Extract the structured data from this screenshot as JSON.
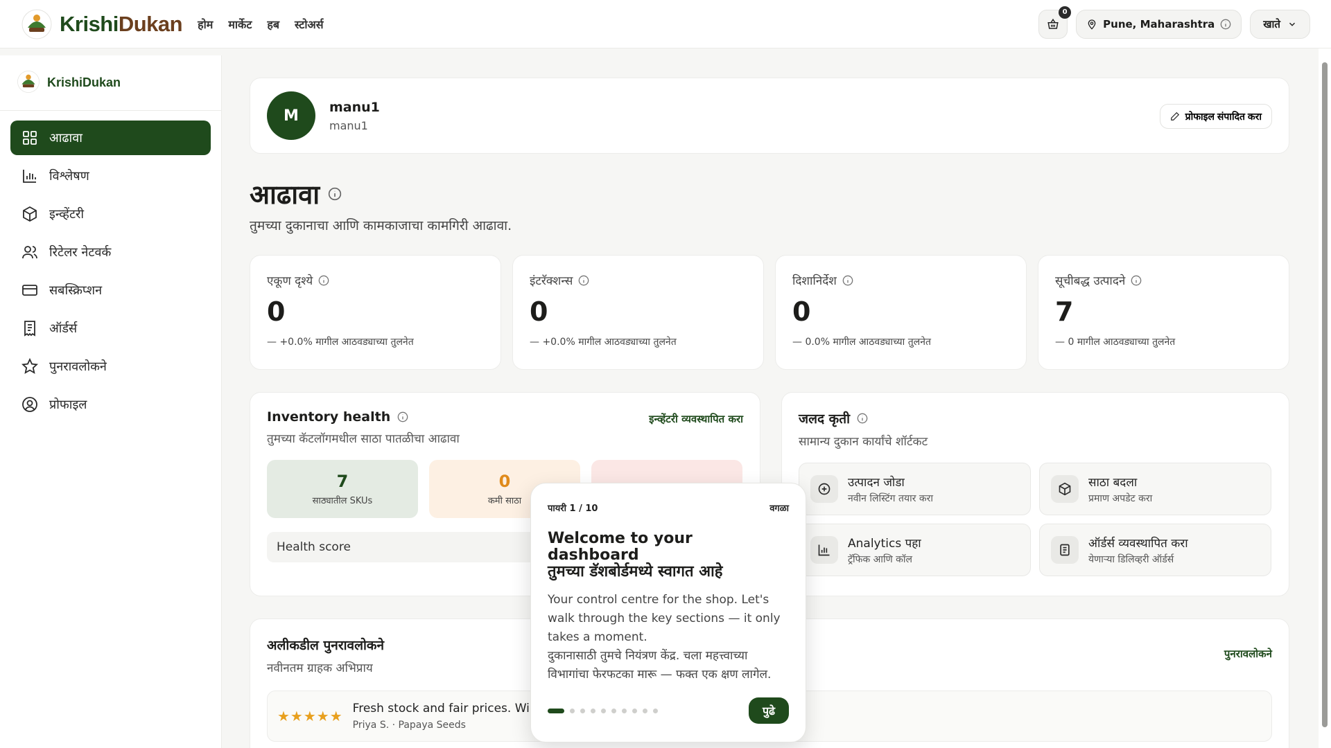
{
  "topbar": {
    "brand_k": "Krishi",
    "brand_d": "Dukan",
    "nav": [
      "होम",
      "मार्केट",
      "हब",
      "स्टोअर्स"
    ],
    "cart_count": "0",
    "location": "Pune, Maharashtra",
    "account": "खाते"
  },
  "sidebar": {
    "brand": "KrishiDukan",
    "items": [
      {
        "label": "आढावा",
        "icon": "grid-icon"
      },
      {
        "label": "विश्लेषण",
        "icon": "bar-chart-icon"
      },
      {
        "label": "इन्व्हेंटरी",
        "icon": "box-icon"
      },
      {
        "label": "रिटेलर नेटवर्क",
        "icon": "users-icon"
      },
      {
        "label": "सबस्क्रिप्शन",
        "icon": "card-icon"
      },
      {
        "label": "ऑर्डर्स",
        "icon": "receipt-icon"
      },
      {
        "label": "पुनरावलोकने",
        "icon": "star-icon"
      },
      {
        "label": "प्रोफाइल",
        "icon": "user-circle-icon"
      }
    ]
  },
  "profile": {
    "initial": "M",
    "name": "manu1",
    "username": "manu1",
    "edit_label": "प्रोफाइल संपादित करा"
  },
  "page": {
    "title": "आढावा",
    "subtitle": "तुमच्या दुकानाचा आणि कामकाजाचा कामगिरी आढावा."
  },
  "stats": [
    {
      "label": "एकूण दृश्ये",
      "value": "0",
      "change": "— +0.0%",
      "suffix": "मागील आठवड्याच्या तुलनेत"
    },
    {
      "label": "इंटरॅक्शन्स",
      "value": "0",
      "change": "— +0.0%",
      "suffix": "मागील आठवड्याच्या तुलनेत"
    },
    {
      "label": "दिशानिर्देश",
      "value": "0",
      "change": "— 0.0%",
      "suffix": "मागील आठवड्याच्या तुलनेत"
    },
    {
      "label": "सूचीबद्ध उत्पादने",
      "value": "7",
      "change": "— 0",
      "suffix": "मागील आठवड्याच्या तुलनेत"
    }
  ],
  "inventory": {
    "title": "Inventory health",
    "subtitle": "तुमच्या कॅटलॉगमधील साठा पातळीचा आढावा",
    "manage_link": "इन्व्हेंटरी व्यवस्थापित करा",
    "tiles": [
      {
        "value": "7",
        "label": "साठ्यातील SKUs",
        "bg": "#e4ebe3",
        "color": "#1f4a1c"
      },
      {
        "value": "0",
        "label": "कमी साठा",
        "bg": "#fdf0e3",
        "color": "#e08a1a"
      },
      {
        "value": "",
        "label": "",
        "bg": "#fbe7e5",
        "color": "#c43d2f"
      }
    ],
    "health_label": "Health score"
  },
  "quick": {
    "title": "जलद कृती",
    "subtitle": "सामान्य दुकान कार्यांचे शॉर्टकट",
    "items": [
      {
        "title": "उत्पादन जोडा",
        "sub": "नवीन लिस्टिंग तयार करा",
        "icon": "plus-circle-icon"
      },
      {
        "title": "साठा बदला",
        "sub": "प्रमाण अपडेट करा",
        "icon": "box-icon"
      },
      {
        "title": "Analytics पहा",
        "sub": "ट्रॅफिक आणि कॉल",
        "icon": "bar-chart-icon"
      },
      {
        "title": "ऑर्डर्स व्यवस्थापित करा",
        "sub": "येणाऱ्या डिलिव्हरी ऑर्डर्स",
        "icon": "document-icon"
      }
    ]
  },
  "reviews": {
    "title": "अलीकडील पुनरावलोकने",
    "subtitle": "नवीनतम ग्राहक अभिप्राय",
    "link": "पुनरावलोकने",
    "items": [
      {
        "stars": "★★★★★",
        "text": "Fresh stock and fair prices. Wi",
        "meta": "Priya S. · Papaya Seeds"
      }
    ]
  },
  "tour": {
    "step": "पायरी 1 / 10",
    "skip": "वगळा",
    "title_en": "Welcome to your dashboard",
    "title_mr": "तुमच्या डॅशबोर्डमध्ये स्वागत आहे",
    "body_en": "Your control centre for the shop. Let's walk through the key sections — it only takes a moment.",
    "body_mr": "दुकानासाठी तुमचे नियंत्रण केंद्र. चला महत्त्वाच्या विभागांचा फेरफटका मारू — फक्त एक क्षण लागेल.",
    "next": "पुढे",
    "dots": 10,
    "active_dot": 1
  },
  "colors": {
    "primary": "#1f4a1c",
    "brand_brown": "#6b3f1e",
    "star": "#e8a01f"
  }
}
